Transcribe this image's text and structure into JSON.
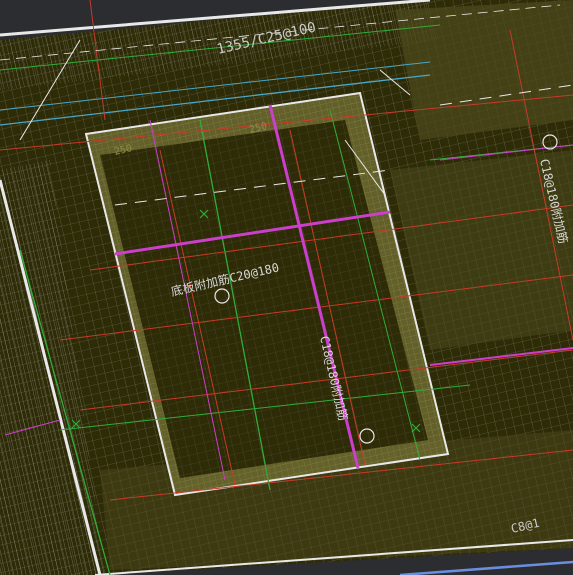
{
  "drawing": {
    "annotations": {
      "top_dimension": "1355/C25@100",
      "center_left_rebar": "底板附加筋C20@180",
      "center_vertical_rebar": "C18@180附加筋",
      "right_vertical_rebar": "C18@180附加筋",
      "top_small_1": "250",
      "top_small_2": "250",
      "bottom_right": "C8@1"
    },
    "colors": {
      "background": "#2b2d30",
      "slab_fill": "#2e2b07",
      "hatch_yellow": "#8f8c48",
      "linework_white": "#e8e8e8",
      "rebar_magenta": "#cc3fcc",
      "rebar_red": "#c83a2a",
      "axis_green": "#2fae3a",
      "cyan_line": "#4aa7c9",
      "blue_line": "#6a8fe0"
    }
  }
}
